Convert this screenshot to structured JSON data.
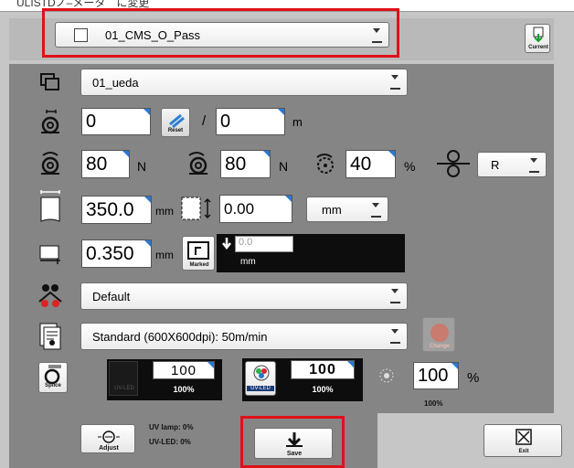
{
  "top_strip_text": "ULISTDノ‒メータ　に変更",
  "job_select": {
    "label": "01_CMS_O_Pass"
  },
  "current_button": {
    "label": "Current"
  },
  "user_select": {
    "label": "01_ueda"
  },
  "length": {
    "current": "0",
    "total": "0",
    "unit": "m",
    "reset_label": "Reset",
    "separator": "/"
  },
  "tension": {
    "feed_value": "80",
    "feed_unit": "N",
    "rewind_value": "80",
    "rewind_unit": "N",
    "percent_value": "40",
    "percent_unit": "%",
    "direction_value": "R"
  },
  "width": {
    "value": "350.0",
    "unit": "mm",
    "offset_value": "0.00",
    "offset_unit_select": "mm"
  },
  "thickness": {
    "value": "0.350",
    "unit": "mm",
    "marked_label": "Marked",
    "mark_value": "0.0",
    "mark_unit": "mm"
  },
  "mode_select": {
    "label": "Default"
  },
  "resolution_select": {
    "label": "Standard (600X600dpi): 50m/min"
  },
  "change_button": {
    "label": "Change"
  },
  "uv": {
    "splice_label": "Splice",
    "led1_label": "UV-LED",
    "led1_value": "100",
    "led1_percent": "100%",
    "led2_label": "UV-LED",
    "led2_value": "100",
    "led2_percent": "100%",
    "lamp_value": "100",
    "lamp_unit": "%",
    "lamp_sub": "100%"
  },
  "adjust": {
    "label": "Adjust",
    "uv_lamp_status": "UV lamp: 0%",
    "uv_led_status": "UV-LED: 0%"
  },
  "save_button": {
    "label": "Save"
  },
  "exit_button": {
    "label": "Exit"
  },
  "colors": {
    "accent_blue": "#2a78d4",
    "highlight_red": "#e0101a",
    "panel_dark": "#858585",
    "panel_light": "#c6c6c6"
  }
}
